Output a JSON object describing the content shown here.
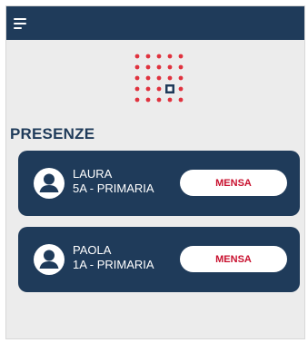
{
  "header": {
    "menu_icon": "hamburger-menu-icon"
  },
  "logo": {
    "icon": "dot-grid-logo",
    "dot_color": "#e0323e",
    "accent_color": "#1f3b5a"
  },
  "page": {
    "title": "PRESENZE"
  },
  "students": [
    {
      "name": "LAURA",
      "class_label": "5A - PRIMARIA",
      "action_label": "MENSA",
      "avatar_icon": "user-avatar-icon"
    },
    {
      "name": "PAOLA",
      "class_label": "1A - PRIMARIA",
      "action_label": "MENSA",
      "avatar_icon": "user-avatar-icon"
    }
  ],
  "colors": {
    "primary": "#1f3b5a",
    "accent": "#c8102e",
    "background": "#ececec"
  }
}
